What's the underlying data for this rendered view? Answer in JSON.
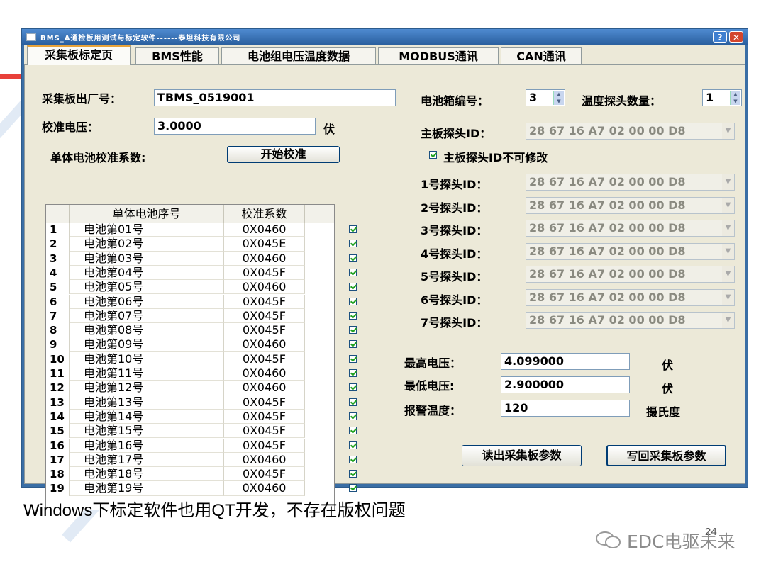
{
  "window": {
    "title": "BMS_A通检板用测试与标定软件------泰坦科技有限公司",
    "help": "?",
    "close": "✕"
  },
  "tabs": [
    {
      "label": "采集板标定页",
      "active": true
    },
    {
      "label": "BMS性能"
    },
    {
      "label": "电池组电压温度数据"
    },
    {
      "label": "MODBUS通讯"
    },
    {
      "label": "CAN通讯"
    }
  ],
  "form": {
    "serial_label": "采集板出厂号：",
    "serial_value": "TBMS_0519001",
    "voltage_label": "校准电压：",
    "voltage_value": "3.0000",
    "voltage_unit": "伏",
    "coef_label": "单体电池校准系数:",
    "start_btn": "开始校准",
    "box_label": "电池箱编号：",
    "box_value": "3",
    "probe_count_label": "温度探头数量：",
    "probe_count_value": "1",
    "main_probe_label": "主板探头ID：",
    "main_probe_value": "28 67 16 A7 02 00 00 D8",
    "lock_label": "主板探头ID不可修改",
    "probes": [
      {
        "label": "1号探头ID：",
        "value": "28 67 16 A7 02 00 00 D8"
      },
      {
        "label": "2号探头ID：",
        "value": "28 67 16 A7 02 00 00 D8"
      },
      {
        "label": "3号探头ID：",
        "value": "28 67 16 A7 02 00 00 D8"
      },
      {
        "label": "4号探头ID：",
        "value": "28 67 16 A7 02 00 00 D8"
      },
      {
        "label": "5号探头ID：",
        "value": "28 67 16 A7 02 00 00 D8"
      },
      {
        "label": "6号探头ID：",
        "value": "28 67 16 A7 02 00 00 D8"
      },
      {
        "label": "7号探头ID：",
        "value": "28 67 16 A7 02 00 00 D8"
      }
    ],
    "max_v_label": "最高电压：",
    "max_v_value": "4.099000",
    "min_v_label": "最低电压:",
    "min_v_value": "2.900000",
    "alarm_label": "报警温度：",
    "alarm_value": "120",
    "unit_v": "伏",
    "unit_t": "摄氏度",
    "read_btn": "读出采集板参数",
    "write_btn": "写回采集板参数"
  },
  "table": {
    "headers": [
      "单体电池序号",
      "校准系数"
    ],
    "rows": [
      {
        "n": "1",
        "name": "电池第01号",
        "coef": "0X0460"
      },
      {
        "n": "2",
        "name": "电池第02号",
        "coef": "0X045E"
      },
      {
        "n": "3",
        "name": "电池第03号",
        "coef": "0X0460"
      },
      {
        "n": "4",
        "name": "电池第04号",
        "coef": "0X045F"
      },
      {
        "n": "5",
        "name": "电池第05号",
        "coef": "0X0460"
      },
      {
        "n": "6",
        "name": "电池第06号",
        "coef": "0X045F"
      },
      {
        "n": "7",
        "name": "电池第07号",
        "coef": "0X045F"
      },
      {
        "n": "8",
        "name": "电池第08号",
        "coef": "0X045F"
      },
      {
        "n": "9",
        "name": "电池第09号",
        "coef": "0X0460"
      },
      {
        "n": "10",
        "name": "电池第10号",
        "coef": "0X045F"
      },
      {
        "n": "11",
        "name": "电池第11号",
        "coef": "0X0460"
      },
      {
        "n": "12",
        "name": "电池第12号",
        "coef": "0X0460"
      },
      {
        "n": "13",
        "name": "电池第13号",
        "coef": "0X045F"
      },
      {
        "n": "14",
        "name": "电池第14号",
        "coef": "0X045F"
      },
      {
        "n": "15",
        "name": "电池第15号",
        "coef": "0X045F"
      },
      {
        "n": "16",
        "name": "电池第16号",
        "coef": "0X045F"
      },
      {
        "n": "17",
        "name": "电池第17号",
        "coef": "0X0460"
      },
      {
        "n": "18",
        "name": "电池第18号",
        "coef": "0X045F"
      },
      {
        "n": "19",
        "name": "电池第19号",
        "coef": "0X0460"
      }
    ]
  },
  "caption": "Windows下标定软件也用QT开发，不存在版权问题",
  "watermark": "EDC电驱未来",
  "page_number": "24"
}
